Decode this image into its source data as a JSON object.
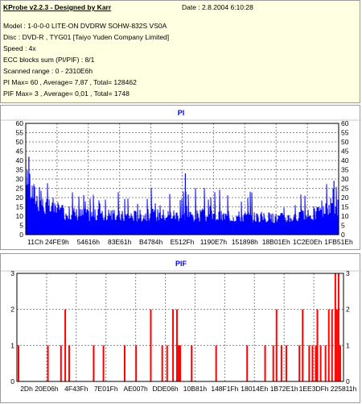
{
  "header": {
    "title": "KProbe v2.2.3 - Designed by Karr",
    "date": "Date : 2.8.2004 6:10:28",
    "lines": [
      "Model : 1-0-0-0 LITE-ON DVDRW SOHW-832S  VS0A",
      "Disc : DVD-R , TYG01 [Taiyo Yuden Company Limited]",
      "Speed : 4x",
      "ECC blocks sum (PI/PIF) : 8/1",
      "Scanned range : 0 - 2310E6h",
      "PI Max= 60 , Average= 7,87 , Total= 128462",
      "PIF Max= 3 , Average= 0,01 , Total= 1748"
    ]
  },
  "colors": {
    "bars": "#0000ff",
    "pif_bars": "#ff0000",
    "info_bg": "#ffffe1"
  },
  "chart_data": [
    {
      "type": "bar",
      "title": "PI",
      "ylim": [
        0,
        60
      ],
      "yticks": [
        0,
        5,
        10,
        15,
        20,
        25,
        30,
        35,
        40,
        45,
        50,
        55,
        60
      ],
      "xtick_labels": [
        "11Ch",
        "24FE9h",
        "54616h",
        "83E61h",
        "B4784h",
        "E512Fh",
        "1190E7h",
        "151898h",
        "18B01Eh",
        "1C2E0Eh",
        "1FB51Eh"
      ],
      "grid": true,
      "profile": {
        "x": [
          0,
          0.02,
          0.05,
          0.1,
          0.2,
          0.3,
          0.4,
          0.5,
          0.6,
          0.7,
          0.8,
          0.9,
          0.95,
          0.98,
          1.0
        ],
        "level": [
          36,
          28,
          20,
          15,
          13,
          12,
          13,
          13,
          12,
          12,
          11,
          12,
          15,
          20,
          18
        ],
        "spike": [
          42,
          35,
          32,
          27,
          26,
          24,
          28,
          27,
          25,
          24,
          22,
          25,
          27,
          29,
          26
        ]
      },
      "noted_peaks": [
        {
          "x": 0.01,
          "y": 42
        },
        {
          "x": 0.51,
          "y": 33
        },
        {
          "x": 0.985,
          "y": 29
        }
      ]
    },
    {
      "type": "bar",
      "title": "PIF",
      "ylim": [
        0,
        3
      ],
      "yticks": [
        0,
        1,
        2,
        3
      ],
      "xtick_labels": [
        "2Dh",
        "20E06h",
        "4F43Fh",
        "7E01Fh",
        "AE007h",
        "DDE06h",
        "10B81h",
        "148F1Fh",
        "18014Eh",
        "1B72E1h",
        "1EE3DFh",
        "225811h"
      ],
      "grid": true,
      "x": [
        0.005,
        0.095,
        0.135,
        0.148,
        0.16,
        0.235,
        0.265,
        0.33,
        0.365,
        0.41,
        0.445,
        0.46,
        0.478,
        0.49,
        0.495,
        0.5,
        0.535,
        0.61,
        0.705,
        0.76,
        0.785,
        0.795,
        0.81,
        0.825,
        0.865,
        0.875,
        0.895,
        0.905,
        0.915,
        0.92,
        0.93,
        0.945,
        0.955,
        0.965,
        0.975,
        0.98,
        0.985,
        0.99
      ],
      "values": [
        1,
        1,
        1,
        2,
        1,
        1,
        1,
        1,
        1,
        2,
        1,
        1,
        2,
        2,
        1,
        1,
        1,
        1,
        1,
        1,
        1,
        2,
        1,
        1,
        1,
        2,
        1,
        1,
        1,
        2,
        1,
        1,
        2,
        2,
        3,
        2,
        3,
        1
      ]
    }
  ]
}
